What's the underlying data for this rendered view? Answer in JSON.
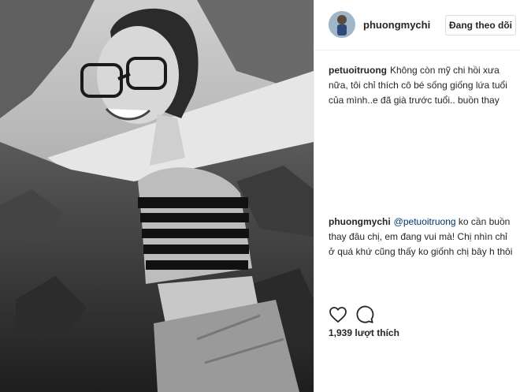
{
  "post": {
    "author": "phuongmychi",
    "follow_label": "Đang theo dõi",
    "comments": [
      {
        "user": "petuoitruong",
        "text": "Không còn mỹ chi hồi xưa nữa, tôi chỉ thích cô bé sống giống lứa tuổi của mình..e đã già trước tuổi.. buồn thay"
      },
      {
        "user": "phuongmychi",
        "mention": "@petuoitruong",
        "text": " ko cần buồn thay đâu chị, em đang vui mà! Chị nhìn chỉ ở quá khứ cũng thấy ko giốnh chị bây h thôi"
      }
    ],
    "likes": "1,939 lượt thích",
    "icons": {
      "like": "heart-icon",
      "comment": "comment-bubble-icon"
    }
  }
}
